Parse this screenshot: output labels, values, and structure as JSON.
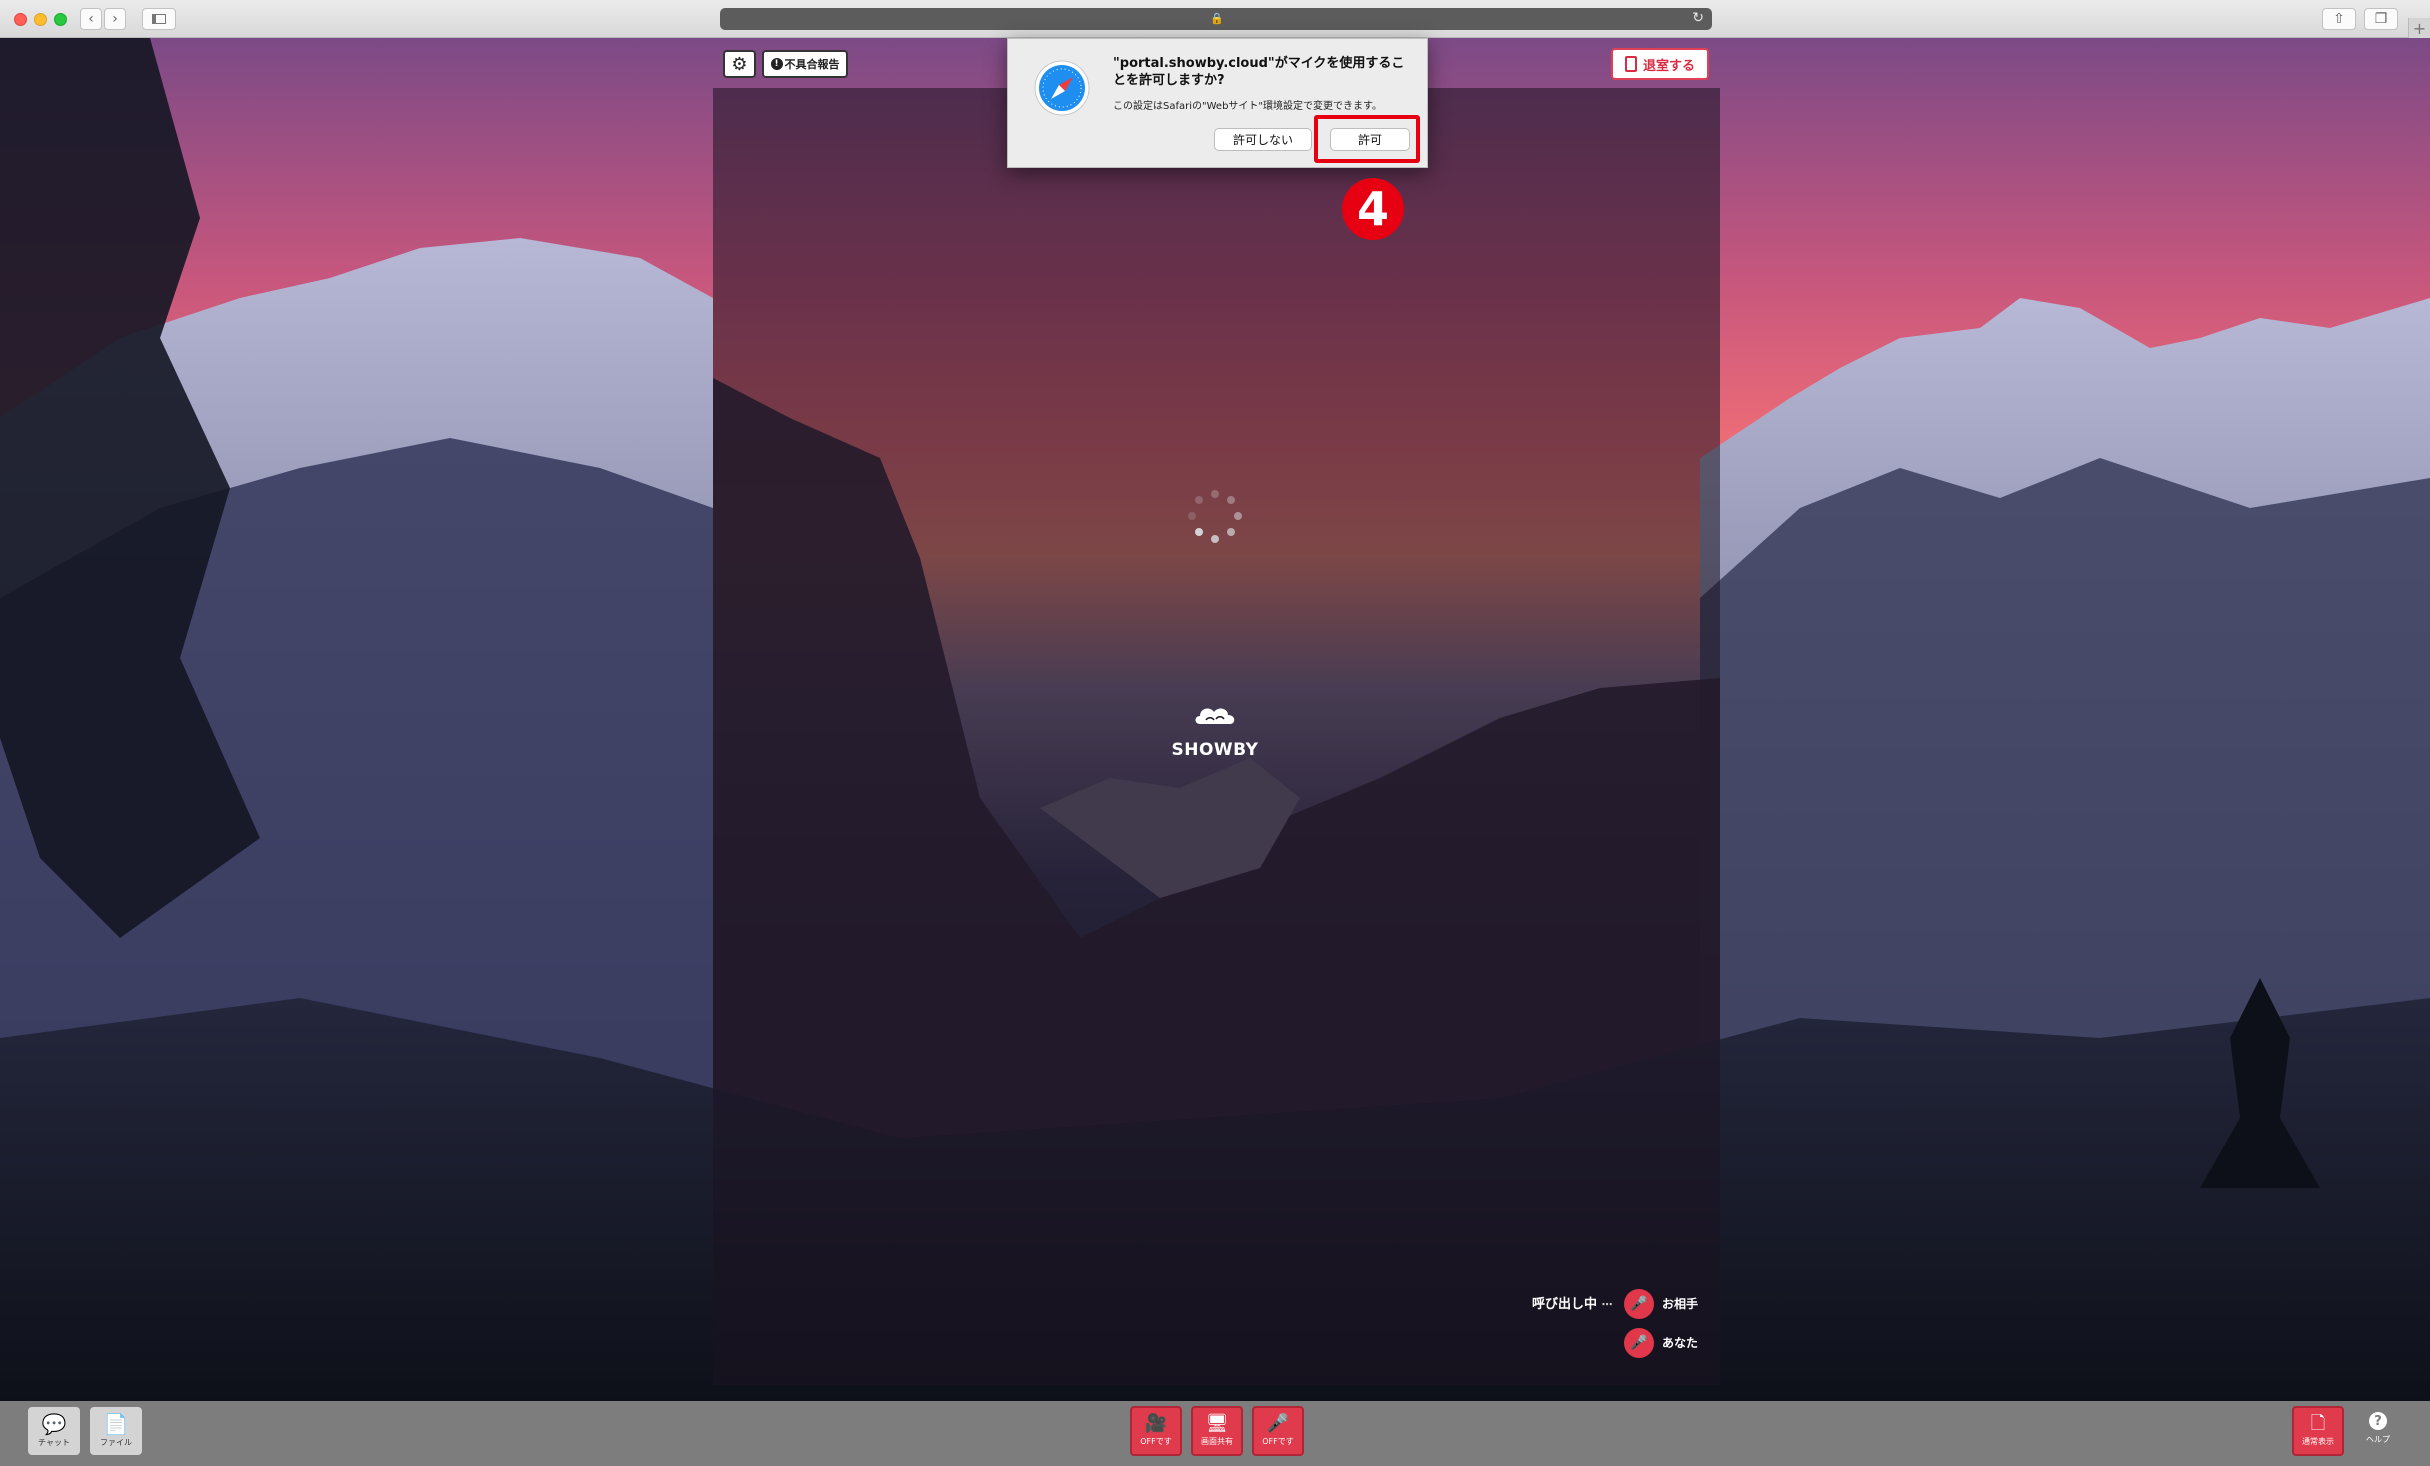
{
  "browser": {
    "icons": {
      "back": "chevron-left-icon",
      "forward": "chevron-right-icon",
      "sidebar": "sidebar-icon",
      "lock": "lock-icon",
      "reload": "reload-icon",
      "share": "share-icon",
      "tabs": "tabs-icon",
      "new_tab": "plus-icon"
    }
  },
  "room": {
    "report_label": "不具合報告",
    "exit_label": "退室する",
    "brand": "SHOWBY",
    "calling_label": "呼び出し中",
    "partner_label": "お相手",
    "you_label": "あなた"
  },
  "dialog": {
    "title": "\"portal.showby.cloud\"がマイクを使用することを許可しますか?",
    "subtitle": "この設定はSafariの\"Webサイト\"環境設定で変更できます。",
    "deny_label": "許可しない",
    "allow_label": "許可"
  },
  "annotation": {
    "step_number": "4",
    "color": "#e60012"
  },
  "bottombar": {
    "chat_label": "チャット",
    "file_label": "ファイル",
    "camera_label": "OFFです",
    "screen_share_label": "画面共有",
    "mic_label": "OFFです",
    "layout_label": "通常表示",
    "help_label": "ヘルプ"
  },
  "colors": {
    "accent_red": "#e0374a",
    "exit_border": "#e04155"
  }
}
